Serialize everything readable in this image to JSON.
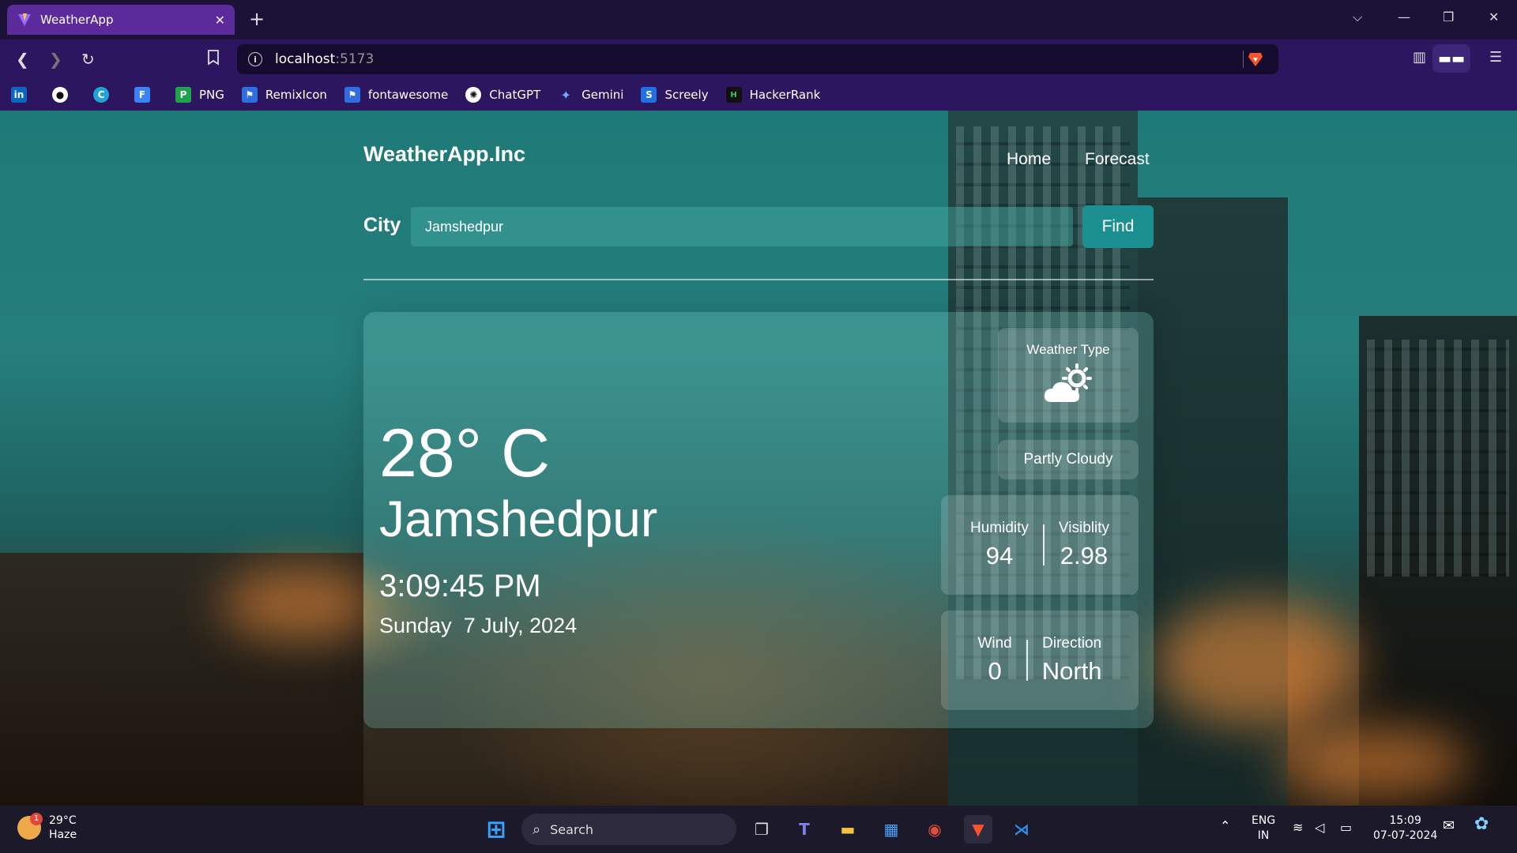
{
  "browser": {
    "tab_title": "WeatherApp",
    "tab_close": "✕",
    "new_tab": "+",
    "url_host": "localhost",
    "url_port": ":5173",
    "bookmarks": [
      "",
      "",
      "",
      "",
      "PNG",
      "RemixIcon",
      "fontawesome",
      "ChatGPT",
      "Gemini",
      "Screely",
      "HackerRank"
    ]
  },
  "app": {
    "brand": "WeatherApp.Inc",
    "nav": {
      "home": "Home",
      "forecast": "Forecast"
    },
    "search": {
      "label": "City",
      "value": "Jamshedpur",
      "button": "Find"
    },
    "current": {
      "temperature": "28° C",
      "city": "Jamshedpur",
      "time": "3:09:45 PM",
      "day": "Sunday",
      "date": "7 July, 2024"
    },
    "weather_type": {
      "label": "Weather Type",
      "icon": "cloud-sun-icon",
      "condition": "Partly Cloudy"
    },
    "humidity": {
      "label": "Humidity",
      "value": "94"
    },
    "visibility": {
      "label": "Visiblity",
      "value": "2.98"
    },
    "wind": {
      "label": "Wind",
      "value": "0"
    },
    "direction": {
      "label": "Direction",
      "value": "North"
    }
  },
  "taskbar": {
    "weather_temp": "29°C",
    "weather_desc": "Haze",
    "weather_badge": "1",
    "search_placeholder": "Search",
    "lang_top": "ENG",
    "lang_bottom": "IN",
    "clock_time": "15:09",
    "clock_date": "07-07-2024"
  }
}
